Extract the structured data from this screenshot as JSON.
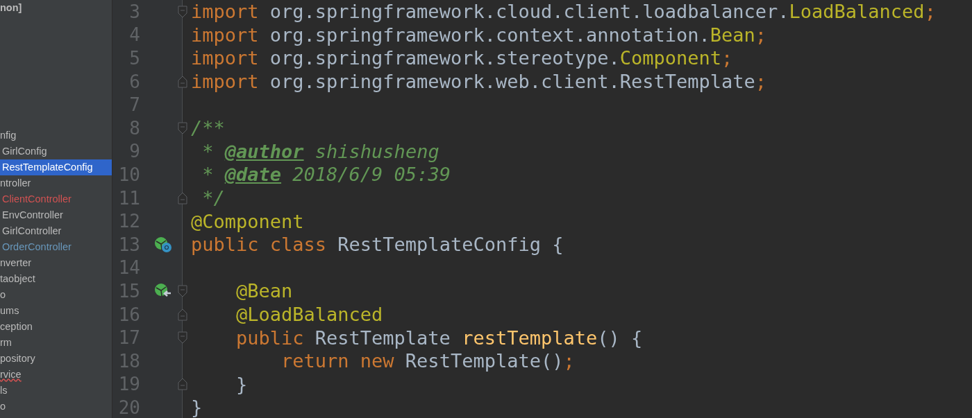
{
  "project_tree": {
    "items": [
      {
        "label": "non]",
        "kind": "root",
        "selected": false
      },
      {
        "label": "nfig",
        "kind": "folder",
        "selected": false
      },
      {
        "label": "GirlConfig",
        "kind": "file",
        "selected": false
      },
      {
        "label": "RestTemplateConfig",
        "kind": "file",
        "selected": true
      },
      {
        "label": "ntroller",
        "kind": "folder",
        "selected": false
      },
      {
        "label": "ClientController",
        "kind": "file",
        "selected": false,
        "color": "#d25252"
      },
      {
        "label": "EnvController",
        "kind": "file",
        "selected": false
      },
      {
        "label": "GirlController",
        "kind": "file",
        "selected": false
      },
      {
        "label": "OrderController",
        "kind": "file",
        "selected": false,
        "color": "#6897bb"
      },
      {
        "label": "nverter",
        "kind": "folder",
        "selected": false
      },
      {
        "label": "taobject",
        "kind": "folder",
        "selected": false
      },
      {
        "label": "o",
        "kind": "folder",
        "selected": false
      },
      {
        "label": "ums",
        "kind": "folder",
        "selected": false
      },
      {
        "label": "ception",
        "kind": "folder",
        "selected": false
      },
      {
        "label": "rm",
        "kind": "folder",
        "selected": false
      },
      {
        "label": "pository",
        "kind": "folder",
        "selected": false
      },
      {
        "label": "rvice",
        "kind": "folder",
        "selected": false,
        "error": true
      },
      {
        "label": "ls",
        "kind": "folder",
        "selected": false
      },
      {
        "label": "o",
        "kind": "folder",
        "selected": false
      }
    ]
  },
  "editor": {
    "lines": [
      {
        "number": "3",
        "fold_start": true,
        "tokens": [
          {
            "t": "import ",
            "kind": "keyword"
          },
          {
            "t": "org.springframework.cloud.client.loadbalancer.",
            "kind": "plain"
          },
          {
            "t": "LoadBalanced",
            "kind": "annotation"
          },
          {
            "t": ";",
            "kind": "keyword"
          }
        ]
      },
      {
        "number": "4",
        "tokens": [
          {
            "t": "import ",
            "kind": "keyword"
          },
          {
            "t": "org.springframework.context.annotation.",
            "kind": "plain"
          },
          {
            "t": "Bean",
            "kind": "annotation"
          },
          {
            "t": ";",
            "kind": "keyword"
          }
        ]
      },
      {
        "number": "5",
        "tokens": [
          {
            "t": "import ",
            "kind": "keyword"
          },
          {
            "t": "org.springframework.stereotype.",
            "kind": "plain"
          },
          {
            "t": "Component",
            "kind": "annotation"
          },
          {
            "t": ";",
            "kind": "keyword"
          }
        ]
      },
      {
        "number": "6",
        "fold_end": true,
        "tokens": [
          {
            "t": "import ",
            "kind": "keyword"
          },
          {
            "t": "org.springframework.web.client.RestTemplate",
            "kind": "plain"
          },
          {
            "t": ";",
            "kind": "keyword"
          }
        ]
      },
      {
        "number": "7"
      },
      {
        "number": "8",
        "fold_start": true,
        "tokens": [
          {
            "t": "/**",
            "kind": "doc"
          }
        ]
      },
      {
        "number": "9",
        "tokens": [
          {
            "t": " * ",
            "kind": "doc"
          },
          {
            "t": "@author",
            "kind": "doctag"
          },
          {
            "t": " shishusheng",
            "kind": "doc"
          }
        ]
      },
      {
        "number": "10",
        "tokens": [
          {
            "t": " * ",
            "kind": "doc"
          },
          {
            "t": "@date",
            "kind": "doctag"
          },
          {
            "t": " 2018/6/9 05:39",
            "kind": "doc"
          }
        ]
      },
      {
        "number": "11",
        "fold_end": true,
        "tokens": [
          {
            "t": " */",
            "kind": "doc"
          }
        ]
      },
      {
        "number": "12",
        "tokens": [
          {
            "t": "@Component",
            "kind": "annotation"
          }
        ]
      },
      {
        "number": "13",
        "bean_class": true,
        "tokens": [
          {
            "t": "public class ",
            "kind": "keyword"
          },
          {
            "t": "RestTemplateConfig {",
            "kind": "plain"
          }
        ]
      },
      {
        "number": "14"
      },
      {
        "number": "15",
        "bean_method": true,
        "fold_start": true,
        "tokens": [
          {
            "t": "    @Bean",
            "kind": "annotation"
          }
        ]
      },
      {
        "number": "16",
        "fold_end": true,
        "tokens": [
          {
            "t": "    @LoadBalanced",
            "kind": "annotation"
          }
        ]
      },
      {
        "number": "17",
        "fold_start": true,
        "tokens": [
          {
            "t": "    public ",
            "kind": "keyword"
          },
          {
            "t": "RestTemplate ",
            "kind": "plain"
          },
          {
            "t": "restTemplate",
            "kind": "method"
          },
          {
            "t": "() {",
            "kind": "plain"
          }
        ]
      },
      {
        "number": "18",
        "tokens": [
          {
            "t": "        return new ",
            "kind": "keyword"
          },
          {
            "t": "RestTemplate()",
            "kind": "plain"
          },
          {
            "t": ";",
            "kind": "keyword"
          }
        ]
      },
      {
        "number": "19",
        "fold_end": true,
        "tokens": [
          {
            "t": "    }",
            "kind": "plain"
          }
        ]
      },
      {
        "number": "20",
        "tokens": [
          {
            "t": "}",
            "kind": "plain"
          }
        ]
      }
    ]
  }
}
